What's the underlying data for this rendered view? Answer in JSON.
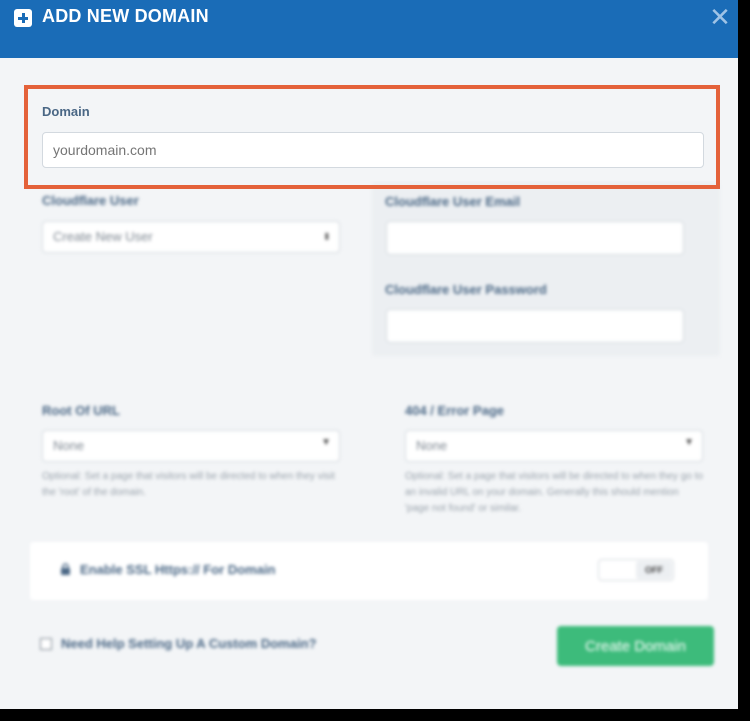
{
  "header": {
    "title": "ADD NEW DOMAIN",
    "close_symbol": "✕"
  },
  "domain": {
    "label": "Domain",
    "placeholder": "yourdomain.com",
    "value": ""
  },
  "cloudflare_user": {
    "label": "Cloudflare User",
    "selected": "Create New User"
  },
  "cloudflare_email": {
    "label": "Cloudflare User Email",
    "value": ""
  },
  "cloudflare_password": {
    "label": "Cloudflare User Password",
    "value": ""
  },
  "root_url": {
    "label": "Root Of URL",
    "selected": "None",
    "hint": "Optional: Set a page that visitors will be directed to when they visit the 'root' of the domain."
  },
  "error_page": {
    "label": "404 / Error Page",
    "selected": "None",
    "hint": "Optional: Set a page that visitors will be directed to when they go to an invalid URL on your domain. Generally this should mention 'page not found' or similar."
  },
  "ssl": {
    "label": "Enable SSL Https:// For Domain",
    "toggle_state": "OFF"
  },
  "help": {
    "label": "Need Help Setting Up A Custom Domain?"
  },
  "create_button": {
    "label": "Create Domain"
  },
  "colors": {
    "header": "#1a6cb7",
    "highlight": "#e4623a",
    "button": "#3dbb7b"
  },
  "icons": {
    "header": "plus-square-icon",
    "ssl": "lock-icon",
    "close": "close-icon"
  }
}
